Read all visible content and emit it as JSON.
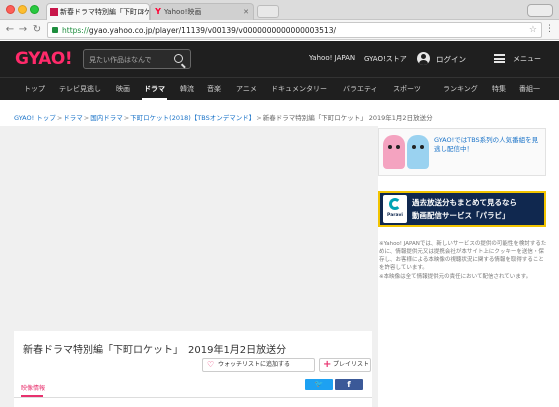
{
  "browser": {
    "tabs": [
      {
        "title": "新春ドラマ特別編「下町ロケッ",
        "active": true
      },
      {
        "title": "Yahoo!映画",
        "active": false
      }
    ],
    "url": {
      "scheme": "https://",
      "rest": "gyao.yahoo.co.jp/player/11139/v00139/v0000000000000003513/"
    }
  },
  "header": {
    "logo": "GYAO!",
    "search_placeholder": "見たい作品はなんで",
    "links": {
      "yahoo": "Yahoo! JAPAN",
      "store": "GYAO!ストア",
      "login": "ログイン",
      "menu": "メニュー"
    }
  },
  "nav": {
    "items": [
      {
        "label": "トップ",
        "active": false
      },
      {
        "label": "テレビ見逃し",
        "active": false
      },
      {
        "label": "映画",
        "active": false
      },
      {
        "label": "ドラマ",
        "active": true
      },
      {
        "label": "韓流",
        "active": false
      },
      {
        "label": "音楽",
        "active": false
      },
      {
        "label": "アニメ",
        "active": false
      },
      {
        "label": "ドキュメンタリー",
        "active": false
      },
      {
        "label": "バラエティ",
        "active": false
      },
      {
        "label": "スポーツ",
        "active": false
      },
      {
        "label": "ランキング",
        "active": false
      },
      {
        "label": "特集",
        "active": false
      },
      {
        "label": "番組一",
        "active": false
      }
    ]
  },
  "breadcrumb": {
    "links": [
      "GYAO! トップ",
      "ドラマ",
      "国内ドラマ",
      "下町ロケット(2018)【TBSオンデマンド】"
    ],
    "current": "新春ドラマ特別編「下町ロケット」 2019年1月2日放送分",
    "separator": ">"
  },
  "episode": {
    "title": "新春ドラマ特別編「下町ロケット」　2019年1月2日放送分",
    "watchlist_label": "ウォッチリストに追加する",
    "playlist_label": "プレイリスト",
    "twitter_glyph": "🐦",
    "facebook_glyph": "f",
    "tab_label": "映像情報"
  },
  "sidebar": {
    "tbs_text": "GYAO!ではTBS系列の人気番組を見逃し配信中！",
    "paravi": {
      "logo_word": "Paravi",
      "line1": "過去放送分もまとめて見るなら",
      "line2": "動画配信サービス「パラビ」"
    },
    "notice": [
      "※Yahoo! JAPANでは、新しいサービスの提供の可能性を検討するために、情報提供元又は提携会社が本サイト上にクッキーを送信・保存し、お客様による本映像の視聴状況に関する情報を取得することを許容しています。",
      "※本映像は全て情報提供元の責任において配信されています。"
    ]
  },
  "colors": {
    "header_bg": "#1f1f1f",
    "logo": "#ff2a6a",
    "accent": "#e8316e",
    "link": "#1a73c8",
    "paravi_bg": "#10284f",
    "paravi_border": "#f2c400"
  }
}
